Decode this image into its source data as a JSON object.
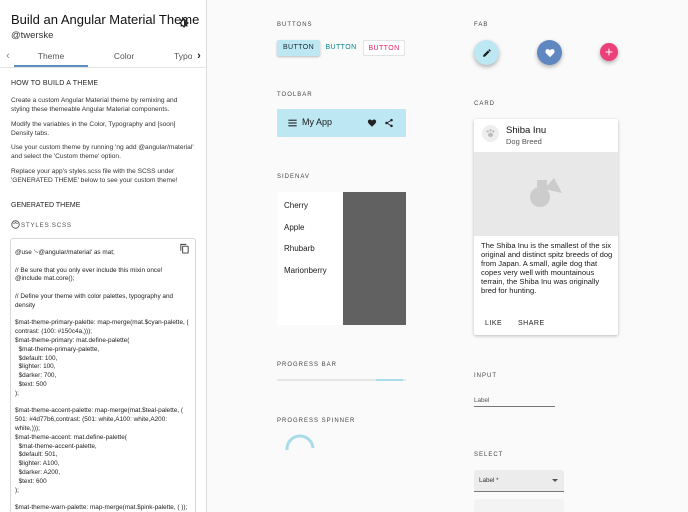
{
  "sidebar": {
    "title": "Build an Angular Material Theme",
    "handle": "@twerske",
    "tabs": [
      {
        "label": "Theme"
      },
      {
        "label": "Color"
      },
      {
        "label": "Typo"
      }
    ],
    "how_to": {
      "heading": "HOW TO BUILD A THEME",
      "paragraphs": [
        "Create a custom Angular Material theme by remixing and styling these themeable Angular Material components.",
        "Modify the variables in the Color, Typography and [soon] Density tabs.",
        "Use your custom theme by running 'ng add @angular/material' and select the 'Custom theme' option.",
        "Replace your app's styles.scss file with the SCSS under 'GENERATED THEME' below to see your custom theme!"
      ]
    },
    "generated": {
      "heading": "GENERATED THEME",
      "file_name": "STYLES.SCSS",
      "code": "@use '~@angular/material' as mat;\n\n// Be sure that you only ever include this mixin once!\n@include mat.core();\n\n// Define your theme with color palettes, typography and density\n\n$mat-theme-primary-palette: map-merge(mat.$cyan-palette, ( contrast: (100: #150c4a,)));\n$mat-theme-primary: mat.define-palette(\n  $mat-theme-primary-palette,\n  $default: 100,\n  $lighter: 100,\n  $darker: 700,\n  $text: 500\n);\n\n$mat-theme-accent-palette: map-merge(mat.$teal-palette, ( 501: #4d77b6,contrast: (501: white,A100: white,A200: white,)));\n$mat-theme-accent: mat.define-palette(\n  $mat-theme-accent-palette,\n  $default: 501,\n  $lighter: A100,\n  $darker: A200,\n  $text: 600\n);\n\n$mat-theme-warn-palette: map-merge(mat.$pink-palette, ( ));"
    }
  },
  "sections": {
    "buttons": "BUTTONS",
    "toolbar": "TOOLBAR",
    "sidenav": "SIDENAV",
    "progress_bar": "PROGRESS BAR",
    "progress_spinner": "PROGRESS SPINNER",
    "fab": "FAB",
    "card": "CARD",
    "input": "INPUT",
    "select": "SELECT"
  },
  "buttons": [
    "BUTTON",
    "BUTTON",
    "BUTTON"
  ],
  "toolbar": {
    "title": "My App",
    "icons": [
      "menu-icon",
      "favorite-icon",
      "share-icon"
    ]
  },
  "sidenav": {
    "items": [
      "Cherry",
      "Apple",
      "Rhubarb",
      "Marionberry"
    ]
  },
  "progress_bar": {
    "value": 0.35
  },
  "fabs": [
    "edit-icon",
    "favorite-icon",
    "add-icon"
  ],
  "card": {
    "title": "Shiba Inu",
    "subtitle": "Dog Breed",
    "body": "The Shiba Inu is the smallest of the six original and distinct spitz breeds of dog from Japan. A small, agile dog that copes very well with mountainous terrain, the Shiba Inu was originally bred for hunting.",
    "actions": [
      "LIKE",
      "SHARE"
    ]
  },
  "input": {
    "label": "Label"
  },
  "select": {
    "label": "Label *"
  },
  "colors": {
    "primary": "#bde7f2",
    "accent": "#5f88c1",
    "warn": "#ec407a",
    "teal_text": "#00868a"
  }
}
